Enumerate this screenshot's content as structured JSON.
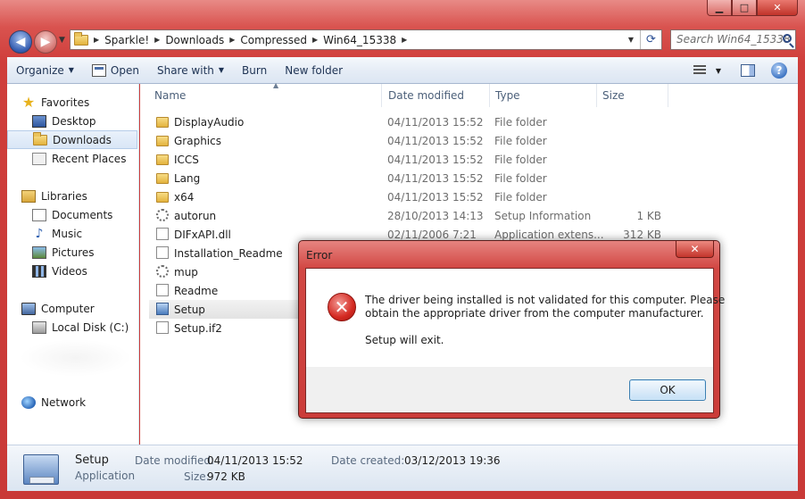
{
  "window": {
    "caption_buttons": {
      "minimize": "▁",
      "maximize": "□",
      "close": "✕"
    }
  },
  "address_bar": {
    "crumbs": [
      "Sparkle!",
      "Downloads",
      "Compressed",
      "Win64_15338"
    ],
    "search_placeholder": "Search Win64_15338"
  },
  "toolbar": {
    "organize": "Organize",
    "open": "Open",
    "share_with": "Share with",
    "burn": "Burn",
    "new_folder": "New folder",
    "help": "?"
  },
  "nav": {
    "favorites": "Favorites",
    "desktop": "Desktop",
    "downloads": "Downloads",
    "recent_places": "Recent Places",
    "libraries": "Libraries",
    "documents": "Documents",
    "music": "Music",
    "pictures": "Pictures",
    "videos": "Videos",
    "computer": "Computer",
    "local_disk": "Local Disk (C:)",
    "network": "Network"
  },
  "columns": {
    "name": "Name",
    "date_modified": "Date modified",
    "type": "Type",
    "size": "Size"
  },
  "files": [
    {
      "name": "DisplayAudio",
      "date": "04/11/2013 15:52",
      "type": "File folder",
      "size": "",
      "icon": "folder-icon"
    },
    {
      "name": "Graphics",
      "date": "04/11/2013 15:52",
      "type": "File folder",
      "size": "",
      "icon": "folder-icon"
    },
    {
      "name": "ICCS",
      "date": "04/11/2013 15:52",
      "type": "File folder",
      "size": "",
      "icon": "folder-icon"
    },
    {
      "name": "Lang",
      "date": "04/11/2013 15:52",
      "type": "File folder",
      "size": "",
      "icon": "folder-icon"
    },
    {
      "name": "x64",
      "date": "04/11/2013 15:52",
      "type": "File folder",
      "size": "",
      "icon": "folder-icon"
    },
    {
      "name": "autorun",
      "date": "28/10/2013 14:13",
      "type": "Setup Information",
      "size": "1 KB",
      "icon": "gear-file-icon"
    },
    {
      "name": "DIFxAPI.dll",
      "date": "02/11/2006 7:21",
      "type": "Application extens...",
      "size": "312 KB",
      "icon": "dll-file-icon"
    },
    {
      "name": "Installation_Readme",
      "date": "",
      "type": "",
      "size": "",
      "icon": "text-file-icon"
    },
    {
      "name": "mup",
      "date": "",
      "type": "",
      "size": "",
      "icon": "gear-file-icon"
    },
    {
      "name": "Readme",
      "date": "",
      "type": "",
      "size": "",
      "icon": "text-file-icon"
    },
    {
      "name": "Setup",
      "date": "",
      "type": "",
      "size": "",
      "icon": "setup-app-icon"
    },
    {
      "name": "Setup.if2",
      "date": "",
      "type": "",
      "size": "",
      "icon": "text-file-icon"
    }
  ],
  "details": {
    "name": "Setup",
    "kind": "Application",
    "date_modified_label": "Date modified:",
    "date_modified": "04/11/2013 15:52",
    "size_label": "Size:",
    "size": "972 KB",
    "date_created_label": "Date created:",
    "date_created": "03/12/2013 19:36"
  },
  "dialog": {
    "title": "Error",
    "close": "✕",
    "message_line1": "The driver being installed is not validated for this computer. Please",
    "message_line2": "obtain the appropriate driver from the computer manufacturer.",
    "message_line3": "Setup will exit.",
    "ok": "OK",
    "error_glyph": "✕"
  }
}
